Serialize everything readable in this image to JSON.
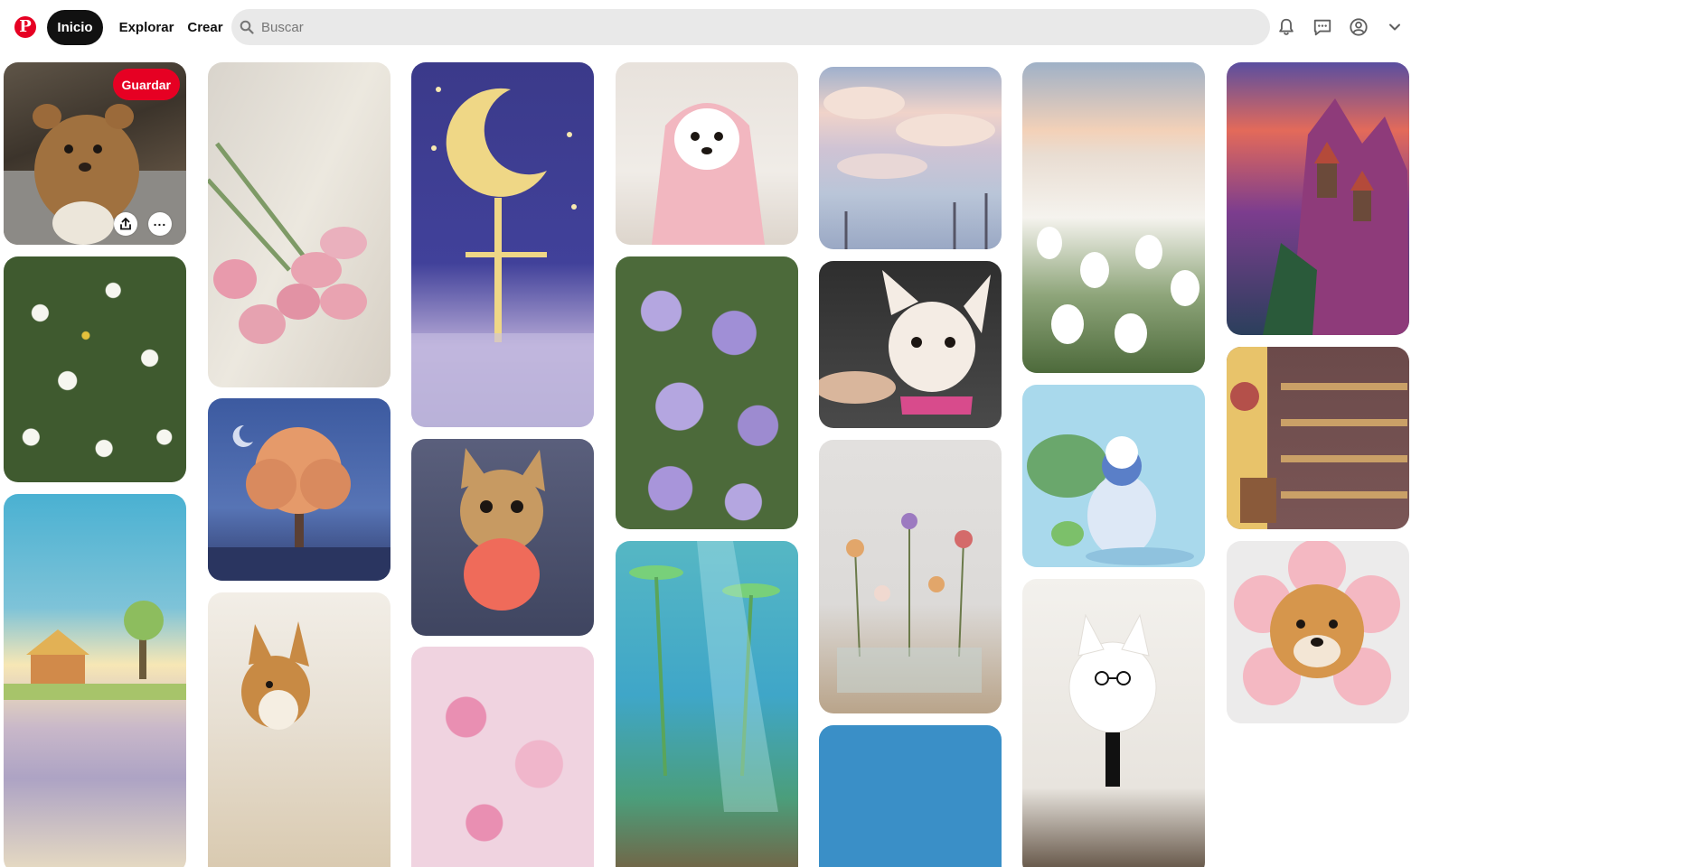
{
  "header": {
    "logo_icon": "pinterest-logo-icon",
    "logo_letter": "P",
    "nav": {
      "home": "Inicio",
      "explore": "Explorar",
      "create": "Crear"
    },
    "search_placeholder": "Buscar",
    "icons": [
      "bell-icon",
      "chat-icon",
      "profile-icon",
      "chevron-down-icon"
    ]
  },
  "colors": {
    "brand": "#e60023",
    "search_bg": "#e9e9e9",
    "active_nav": "#111111"
  },
  "pin_actions": {
    "save_label": "Guardar",
    "share_icon": "share-icon",
    "more_icon": "more-icon"
  },
  "pins": [
    {
      "id": "dog-on-couch",
      "palette": [
        "#6b5a48",
        "#a47a4e",
        "#3d3328"
      ]
    },
    {
      "id": "pink-tulips",
      "palette": [
        "#e8e4dc",
        "#e9a3b1",
        "#7e9a66"
      ]
    },
    {
      "id": "pixel-moon-night",
      "palette": [
        "#3b3a8a",
        "#efd786",
        "#b6a9d6"
      ]
    },
    {
      "id": "puppy-pink-towel",
      "palette": [
        "#e8e2dc",
        "#f2b7c0",
        "#ffffff"
      ]
    },
    {
      "id": "pixel-clouds-sky",
      "palette": [
        "#b9c5d8",
        "#f0d3c9",
        "#9aa8c4"
      ]
    },
    {
      "id": "white-tulip-field",
      "palette": [
        "#f3d1b8",
        "#f5f3ee",
        "#4d6a3b"
      ]
    },
    {
      "id": "pixel-castle-cliff",
      "palette": [
        "#7c3d8e",
        "#e36a5a",
        "#2b3f5c"
      ]
    },
    {
      "id": "daisy-field",
      "palette": [
        "#3f5a2f",
        "#f6f6f0",
        "#e3c13c"
      ]
    },
    {
      "id": "pixel-orange-tree",
      "palette": [
        "#3c5aa0",
        "#e59a6a",
        "#2f3b6b"
      ]
    },
    {
      "id": "chihuahua-sweater",
      "palette": [
        "#3f4560",
        "#c79a62",
        "#ef6b5a"
      ]
    },
    {
      "id": "purple-bellflowers",
      "palette": [
        "#b4a6e0",
        "#7d69bd",
        "#4c6a3a"
      ]
    },
    {
      "id": "chihuahua-car",
      "palette": [
        "#3a3a3a",
        "#f4ece4",
        "#d84b8c"
      ]
    },
    {
      "id": "pixel-tree-girl-rain",
      "palette": [
        "#a9d9ec",
        "#6aa76c",
        "#dde8f6"
      ]
    },
    {
      "id": "pixel-bakery",
      "palette": [
        "#6b4a4a",
        "#caa067",
        "#e8c36a"
      ]
    },
    {
      "id": "pixel-sky-house",
      "palette": [
        "#4ab1d2",
        "#f7e7b5",
        "#c8b7c9"
      ]
    },
    {
      "id": "corgi-floor",
      "palette": [
        "#d8c8ad",
        "#c88a44",
        "#f2eee7"
      ]
    },
    {
      "id": "pink-blossoms",
      "palette": [
        "#f0d3e0",
        "#e98fb2",
        "#7d5a63"
      ]
    },
    {
      "id": "pixel-underwater",
      "palette": [
        "#3fa6c8",
        "#78d07a",
        "#7a5a3c"
      ]
    },
    {
      "id": "wildflowers-vases",
      "palette": [
        "#dcdad8",
        "#e2a66a",
        "#9c7ac0"
      ]
    },
    {
      "id": "samoyed-glasses",
      "palette": [
        "#f0ede8",
        "#ffffff",
        "#5a4a3b"
      ]
    },
    {
      "id": "shiba-flower-hat",
      "palette": [
        "#ecebeb",
        "#f4b8c2",
        "#d6964c"
      ]
    }
  ]
}
